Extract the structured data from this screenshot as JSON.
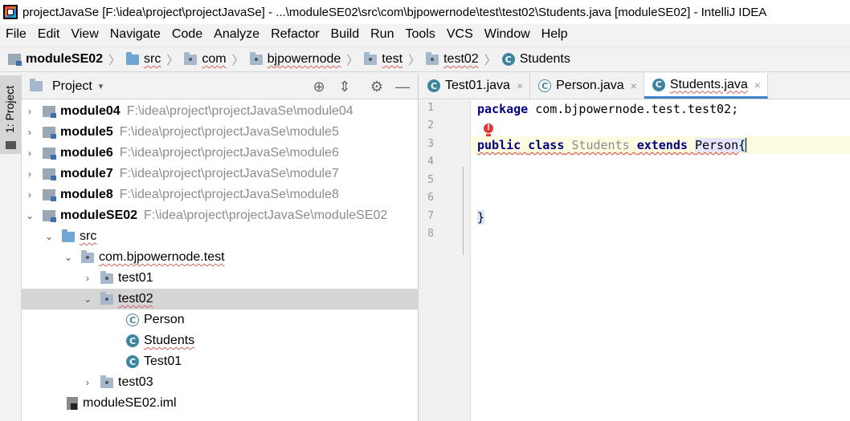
{
  "window": {
    "title": "projectJavaSe [F:\\idea\\project\\projectJavaSe] - ...\\moduleSE02\\src\\com\\bjpowernode\\test\\test02\\Students.java [moduleSE02] - IntelliJ IDEA"
  },
  "menu": [
    "File",
    "Edit",
    "View",
    "Navigate",
    "Code",
    "Analyze",
    "Refactor",
    "Build",
    "Run",
    "Tools",
    "VCS",
    "Window",
    "Help"
  ],
  "breadcrumb": [
    "moduleSE02",
    "src",
    "com",
    "bjpowernode",
    "test",
    "test02",
    "Students"
  ],
  "toolstrip": {
    "project_label": "1: Project"
  },
  "project_panel": {
    "title": "Project",
    "caret": "▾",
    "modules": [
      {
        "name": "module04",
        "path": "F:\\idea\\project\\projectJavaSe\\module04"
      },
      {
        "name": "module5",
        "path": "F:\\idea\\project\\projectJavaSe\\module5"
      },
      {
        "name": "module6",
        "path": "F:\\idea\\project\\projectJavaSe\\module6"
      },
      {
        "name": "module7",
        "path": "F:\\idea\\project\\projectJavaSe\\module7"
      },
      {
        "name": "module8",
        "path": "F:\\idea\\project\\projectJavaSe\\module8"
      },
      {
        "name": "moduleSE02",
        "path": "F:\\idea\\project\\projectJavaSe\\moduleSE02"
      }
    ],
    "src": "src",
    "package": "com.bjpowernode.test",
    "test01": "test01",
    "test02": "test02",
    "classes": [
      "Person",
      "Students",
      "Test01"
    ],
    "test03": "test03",
    "iml": "moduleSE02.iml"
  },
  "editor": {
    "tabs": [
      {
        "label": "Test01.java",
        "close": "×"
      },
      {
        "label": "Person.java",
        "close": "×"
      },
      {
        "label": "Students.java",
        "close": "×"
      }
    ],
    "line_numbers": [
      "1",
      "2",
      "3",
      "4",
      "5",
      "6",
      "7",
      "8"
    ],
    "code": {
      "package_kw": "package",
      "package_name": " com.bjpowernode.test.test02;",
      "public_kw": "public",
      "class_kw": "class",
      "class_name": "Students",
      "extends_kw": "extends",
      "super_name": "Person",
      "open_brace": "{",
      "close_brace": "}"
    },
    "error_marker": "!"
  }
}
